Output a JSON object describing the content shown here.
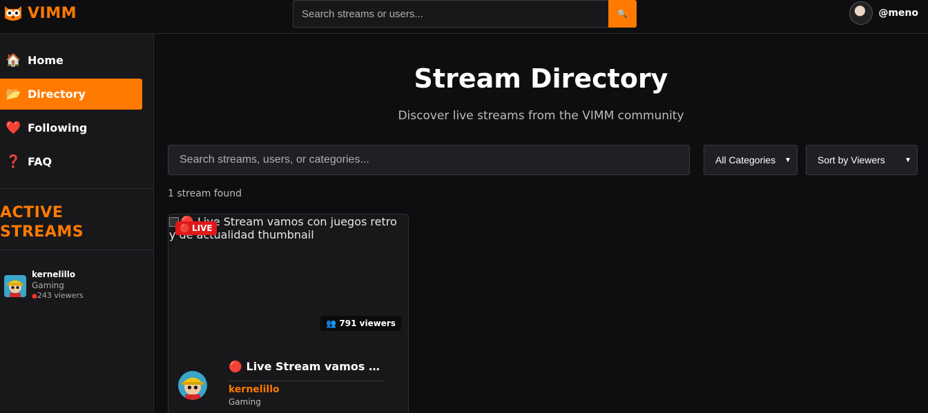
{
  "header": {
    "brand": "VIMM",
    "search_placeholder": "Search streams or users...",
    "search_button_icon": "🔍",
    "username": "@meno"
  },
  "sidebar": {
    "nav": [
      {
        "icon": "🏠",
        "label": "Home",
        "active": false
      },
      {
        "icon": "📂",
        "label": "Directory",
        "active": true
      },
      {
        "icon": "❤️",
        "label": "Following",
        "active": false
      },
      {
        "icon": "❓",
        "label": "FAQ",
        "active": false
      }
    ],
    "active_streams_title": "ACTIVE STREAMS",
    "active_streams": [
      {
        "name": "kernelillo",
        "category": "Gaming",
        "viewers": "243 viewers"
      }
    ]
  },
  "main": {
    "title": "Stream Directory",
    "subtitle": "Discover live streams from the VIMM community",
    "search_placeholder": "Search streams, users, or categories...",
    "category_filter": "All Categories",
    "sort_filter": "Sort by Viewers",
    "result_count": "1 stream found"
  },
  "streams": [
    {
      "thumbnail_alt": "🔴 Live Stream vamos con juegos retro y de actualidad thumbnail",
      "live_badge": "LIVE",
      "live_icon": "🔴",
      "viewers": "791 viewers",
      "viewers_icon": "👥",
      "title": "🔴 Live Stream vamos con juegos retro y de actualidad",
      "user": "kernelillo",
      "category": "Gaming"
    }
  ],
  "colors": {
    "accent": "#ff7a00",
    "live": "#e01818",
    "background": "#0e0e10",
    "panel": "#18181b"
  }
}
